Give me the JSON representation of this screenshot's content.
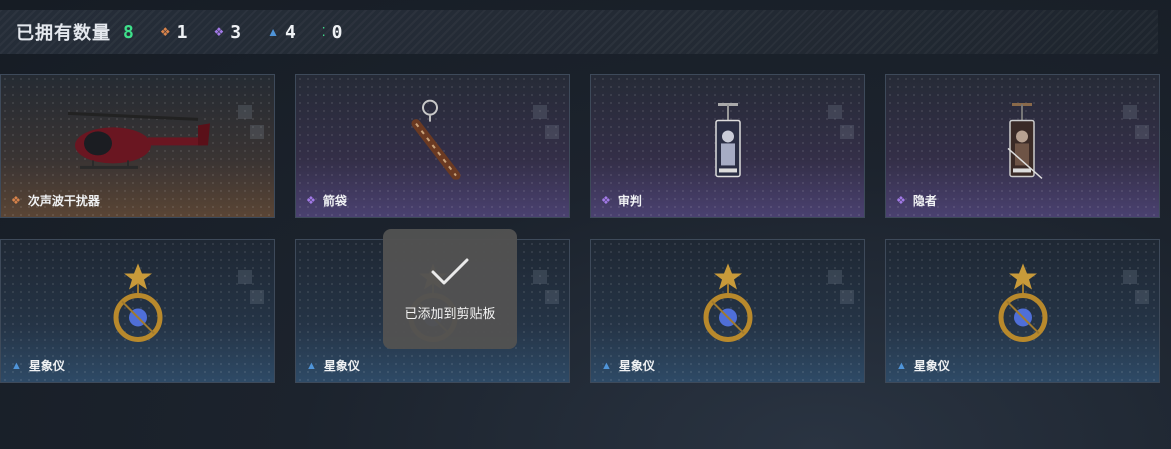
{
  "header": {
    "title": "已拥有数量",
    "total": "8",
    "stats": [
      {
        "icon": "orange-rarity-icon",
        "symbol": "❖",
        "color": "#d9834a",
        "count": "1"
      },
      {
        "icon": "purple-rarity-icon",
        "symbol": "❖",
        "color": "#a37ae8",
        "count": "3"
      },
      {
        "icon": "blue-rarity-icon",
        "symbol": "▲",
        "color": "#4f94d8",
        "count": "4"
      },
      {
        "icon": "green-rarity-icon",
        "symbol": "⁚",
        "color": "#3ee08a",
        "count": "0"
      }
    ]
  },
  "items": [
    {
      "name": "次声波干扰器",
      "rarity": "orange",
      "art": "helicopter-icon"
    },
    {
      "name": "箭袋",
      "rarity": "purple",
      "art": "quiver-icon"
    },
    {
      "name": "审判",
      "rarity": "purple",
      "art": "tarot-card-icon"
    },
    {
      "name": "隐者",
      "rarity": "purple",
      "art": "tarot-card-icon"
    },
    {
      "name": "星象仪",
      "rarity": "blue",
      "art": "astrolabe-icon"
    },
    {
      "name": "星象仪",
      "rarity": "blue",
      "art": "astrolabe-icon"
    },
    {
      "name": "星象仪",
      "rarity": "blue",
      "art": "astrolabe-icon"
    },
    {
      "name": "星象仪",
      "rarity": "blue",
      "art": "astrolabe-icon"
    }
  ],
  "toast": {
    "message": "已添加到剪贴板",
    "icon": "checkmark-icon"
  }
}
